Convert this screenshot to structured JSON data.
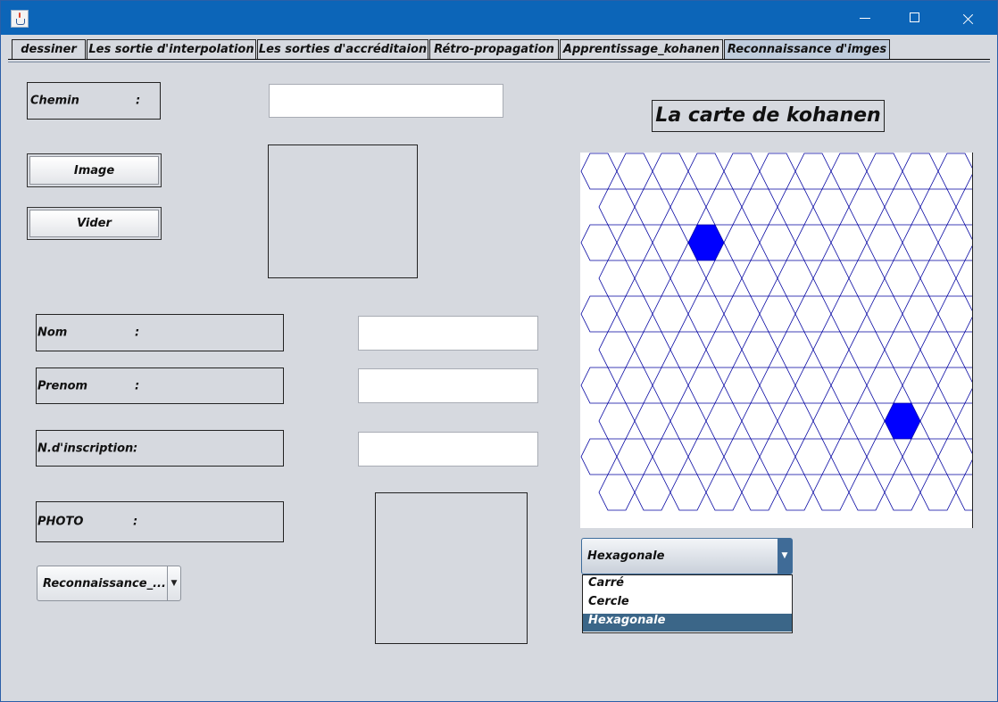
{
  "window": {
    "buttons": {
      "minimize": "minimize-icon",
      "maximize": "maximize-icon",
      "close": "close-icon"
    }
  },
  "tabs": [
    {
      "label": "dessiner",
      "selected": false
    },
    {
      "label": "Les sortie d'interpolation",
      "selected": false
    },
    {
      "label": "Les sorties d'accréditaion",
      "selected": false
    },
    {
      "label": "Rétro-propagation",
      "selected": false
    },
    {
      "label": "Apprentissage_kohanen",
      "selected": false
    },
    {
      "label": "Reconnaissance d'imges",
      "selected": true
    }
  ],
  "form": {
    "chemin": {
      "label": "Chemin",
      "colon": ":",
      "value": ""
    },
    "image_button": "Image",
    "vider_button": "Vider",
    "nom": {
      "label": "Nom",
      "colon": ":",
      "value": ""
    },
    "prenom": {
      "label": "Prenom",
      "colon": ":",
      "value": ""
    },
    "inscription": {
      "label": "N.d'inscription",
      "colon": ":",
      "value": ""
    },
    "photo": {
      "label": "PHOTO",
      "colon": ":"
    },
    "mode_select": "Reconnaissance_..."
  },
  "map": {
    "title": "La carte de kohanen",
    "grid_rows": 10,
    "grid_cols": 11,
    "activated_cells": [
      {
        "row": 2,
        "col": 3
      },
      {
        "row": 7,
        "col": 8
      }
    ],
    "line_color": "#0000a0",
    "active_color": "#0000ff"
  },
  "shape_select": {
    "value": "Hexagonale",
    "options": [
      "Carré",
      "Cercle",
      "Hexagonale"
    ],
    "selected_index": 2
  },
  "colors": {
    "titlebar": "#0c65b8",
    "selection": "#3b6688",
    "background": "#d6d9df"
  }
}
